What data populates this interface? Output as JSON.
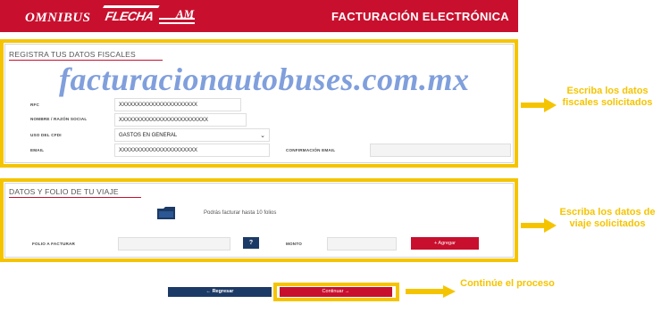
{
  "header": {
    "logo_omnibus": "OMNIBUS",
    "logo_flecha": "FLECHA",
    "logo_am": "AM",
    "title": "FACTURACIÓN ELECTRÓNICA",
    "background_color": "#c8102e"
  },
  "watermark": "facturacionautobuses.com.mx",
  "fiscal": {
    "section_title": "REGISTRA TUS DATOS FISCALES",
    "rfc_label": "RFC",
    "rfc_value": "XXXXXXXXXXXXXXXXXXXXXX",
    "name_label": "NOMBRE / RAZÓN SOCIAL",
    "name_value": "XXXXXXXXXXXXXXXXXXXXXXXXX",
    "cfdi_label": "USO DEL CFDI",
    "cfdi_value": "GASTOS EN GENERAL",
    "email_label": "EMAIL",
    "email_value": "XXXXXXXXXXXXXXXXXXXXXX",
    "confirm_email_label": "CONFIRMACIÓN EMAIL",
    "confirm_email_value": ""
  },
  "trip": {
    "section_title": "DATOS Y FOLIO DE TU VIAJE",
    "hint": "Podrás facturar hasta 10 folios",
    "folio_label": "FOLIO A FACTURAR",
    "folio_value": "",
    "help_label": "?",
    "amount_label": "MONTO",
    "amount_value": "",
    "add_button": "+ Agregar"
  },
  "footer": {
    "back_button": "← Regresar",
    "continue_button": "Continuar →"
  },
  "annotations": {
    "fiscal_note": "Escriba los datos fiscales solicitados",
    "trip_note": "Escriba los datos de viaje solicitados",
    "continue_note": "Continúe el proceso",
    "highlight_color": "#f5c400"
  }
}
